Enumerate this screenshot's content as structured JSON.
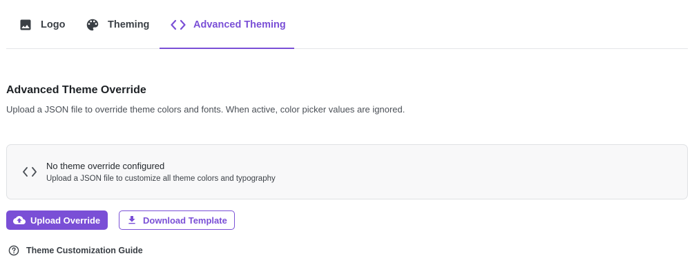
{
  "tabs": [
    {
      "label": "Logo",
      "icon": "image-icon"
    },
    {
      "label": "Theming",
      "icon": "palette-icon"
    },
    {
      "label": "Advanced Theming",
      "icon": "code-icon",
      "active": true
    }
  ],
  "section": {
    "title": "Advanced Theme Override",
    "description": "Upload a JSON file to override theme colors and fonts. When active, color picker values are ignored."
  },
  "status": {
    "icon": "code-icon",
    "title": "No theme override configured",
    "subtitle": "Upload a JSON file to customize all theme colors and typography"
  },
  "actions": {
    "upload_label": "Upload Override",
    "upload_icon": "cloud-upload-icon",
    "download_label": "Download Template",
    "download_icon": "download-icon"
  },
  "guide": {
    "label": "Theme Customization Guide",
    "icon": "help-circle-icon"
  },
  "colors": {
    "accent": "#7a4fd6",
    "text": "#1d2125",
    "muted": "#4a4f56",
    "box_bg": "#f8f8f9",
    "border": "#dfe1e4"
  }
}
